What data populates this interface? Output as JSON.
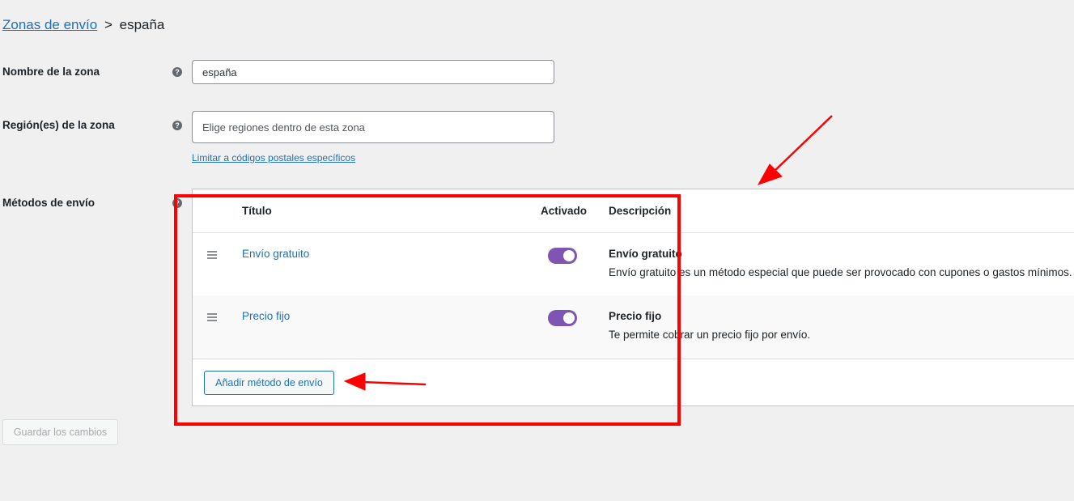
{
  "breadcrumb": {
    "parent_link": "Zonas de envío",
    "separator": ">",
    "current": "españa"
  },
  "zone_name": {
    "label": "Nombre de la zona",
    "value": "españa"
  },
  "zone_regions": {
    "label": "Región(es) de la zona",
    "placeholder": "Elige regiones dentro de esta zona",
    "limit_link": "Limitar a códigos postales específicos"
  },
  "shipping_methods": {
    "label": "Métodos de envío",
    "columns": {
      "title": "Título",
      "enabled": "Activado",
      "description": "Descripción"
    },
    "rows": [
      {
        "title": "Envío gratuito",
        "enabled": true,
        "desc_title": "Envío gratuito",
        "desc_text": "Envío gratuito es un método especial que puede ser provocado con cupones o gastos mínimos."
      },
      {
        "title": "Precio fijo",
        "enabled": true,
        "desc_title": "Precio fijo",
        "desc_text": "Te permite cobrar un precio fijo por envío."
      }
    ],
    "add_button": "Añadir método de envío"
  },
  "save_button": "Guardar los cambios",
  "help_icon_glyph": "?",
  "colors": {
    "link": "#2271b1",
    "toggle_on": "#7f54b3",
    "annotation_red": "#ff0000"
  }
}
